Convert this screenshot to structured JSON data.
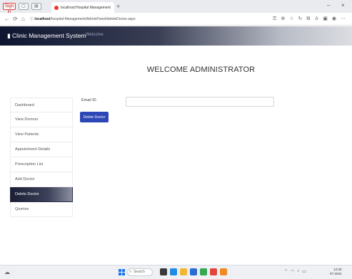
{
  "browser": {
    "window_buttons": [
      "Sign in",
      "",
      ""
    ],
    "tab_title": "localhost:Hospital Management · ×",
    "new_tab": "+",
    "controls": [
      "–",
      "×"
    ],
    "url_host": "localhost",
    "url_path": "/hospital-Management/AdminPanel/deleteDoctor.aspx",
    "toolbar_icons": [
      "key-icon",
      "zoom-icon",
      "star-icon",
      "reload-icon",
      "extensions-icon",
      "favorites-icon",
      "collections-icon",
      "profile-icon",
      "menu-icon"
    ]
  },
  "header": {
    "brand": "Clinic Management System",
    "sub": "Welcome"
  },
  "welcome": "WELCOME ADMINISTRATOR",
  "sidebar": {
    "items": [
      {
        "label": "Dashboard"
      },
      {
        "label": "View Doctors"
      },
      {
        "label": "View Patients"
      },
      {
        "label": "Appointment Details"
      },
      {
        "label": "Prescription List"
      },
      {
        "label": "Add Doctor"
      },
      {
        "label": "Delete Doctor"
      },
      {
        "label": "Queries"
      }
    ],
    "active_index": 6
  },
  "form": {
    "email_label": "Email ID",
    "email_value": "",
    "email_placeholder": "",
    "delete_button": "Delete Doctor"
  },
  "taskbar": {
    "search": "Search",
    "clock_time": "12:30",
    "clock_date": "07-2024",
    "apps": [
      {
        "name": "file-explorer-icon",
        "color": "#3a3a3a"
      },
      {
        "name": "edge-icon",
        "color": "#1f8ce6"
      },
      {
        "name": "folder-icon",
        "color": "#f2b632"
      },
      {
        "name": "store-icon",
        "color": "#2a6bd4"
      },
      {
        "name": "chrome-icon",
        "color": "#34a853"
      },
      {
        "name": "app-red-icon",
        "color": "#e2453c"
      },
      {
        "name": "app-orange-icon",
        "color": "#f08a24"
      }
    ]
  },
  "colors": {
    "header_dark": "#0e1530",
    "button_blue": "#2d47b6",
    "active_item": "#1b1f35"
  }
}
